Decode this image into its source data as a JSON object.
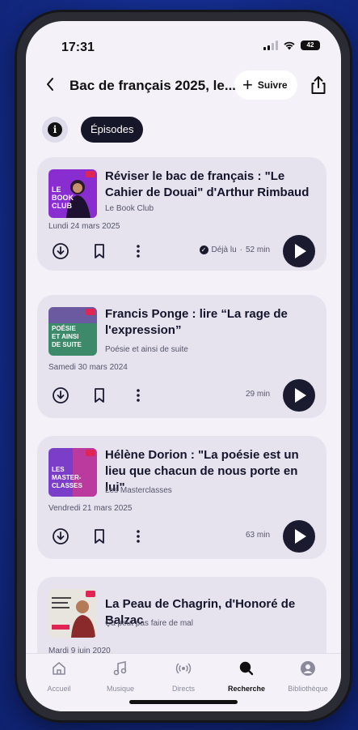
{
  "status_bar": {
    "time": "17:31",
    "battery": "42"
  },
  "header": {
    "back_icon": "chevron-left-icon",
    "title": "Bac de français 2025, le...",
    "follow_label": "Suivre",
    "share_icon": "share-icon"
  },
  "tabs": {
    "info_icon": "info-icon",
    "episodes_label": "Épisodes"
  },
  "episodes": [
    {
      "title": "Réviser le bac de français : \"Le Cahier de Douai\" d'Arthur Rimbaud",
      "show": "Le Book Club",
      "date": "Lundi 24 mars 2025",
      "status": "Déjà lu",
      "duration": "52 min",
      "thumb_text": "LE\nBOOK\nCLUB",
      "thumb_color": "#8a2dd0"
    },
    {
      "title": "Francis Ponge : lire “La rage de l'expression”",
      "show": "Poésie et ainsi de suite",
      "date": "Samedi 30 mars 2024",
      "duration": "29 min",
      "thumb_text": "POÉSIE\nET AINSI\nDE SUITE",
      "thumb_color": "#3d8a6a"
    },
    {
      "title": "Hélène Dorion : \"La poésie est un lieu que chacun de nous porte en lui\"",
      "show": "Les Masterclasses",
      "date": "Vendredi 21 mars 2025",
      "duration": "63 min",
      "thumb_text": "LES\nMASTER-\nCLASSES",
      "thumb_color": "#7a3ec8"
    },
    {
      "title": "La Peau de Chagrin, d'Honoré de Balzac",
      "show": "Ça peut pas faire de mal",
      "date": "Mardi 9 juin 2020",
      "thumb_text": "",
      "thumb_color": "#e8e4de"
    }
  ],
  "bottom_nav": [
    {
      "label": "Accueil",
      "icon": "home-icon"
    },
    {
      "label": "Musique",
      "icon": "music-note-icon"
    },
    {
      "label": "Directs",
      "icon": "broadcast-icon"
    },
    {
      "label": "Recherche",
      "icon": "search-icon",
      "active": true
    },
    {
      "label": "Bibliothèque",
      "icon": "profile-icon"
    }
  ],
  "colors": {
    "accent_dark": "#1b1b30",
    "card_bg": "#e6e3ef",
    "screen_bg": "#f4f2f8",
    "brand_red": "#e02454"
  }
}
